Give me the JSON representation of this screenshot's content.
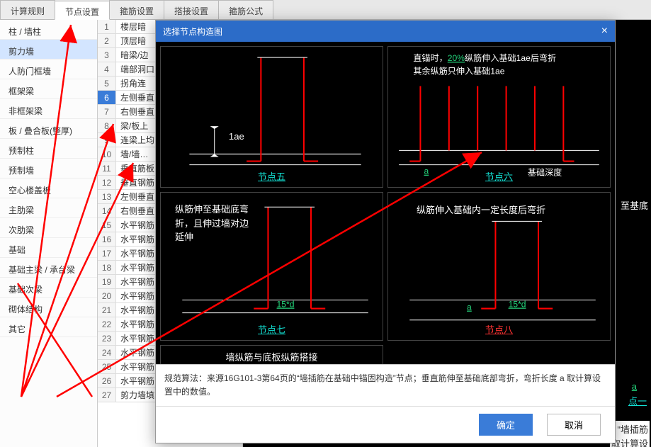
{
  "tabs": [
    "计算规则",
    "节点设置",
    "箍筋设置",
    "搭接设置",
    "箍筋公式"
  ],
  "active_tab_index": 1,
  "sidebar": {
    "items": [
      "柱 / 墙柱",
      "剪力墙",
      "人防门框墙",
      "框架梁",
      "非框架梁",
      "板 / 叠合板(整厚)",
      "预制柱",
      "预制墙",
      "空心楼盖板",
      "主肋梁",
      "次肋梁",
      "基础",
      "基础主梁 / 承台梁",
      "基础次梁",
      "砌体结构",
      "其它"
    ],
    "selected_index": 1
  },
  "grid": {
    "selected_row": 6,
    "rows": [
      "楼层暗",
      "顶层暗",
      "暗梁/边",
      "端部洞口",
      "拐角连",
      "左侧垂直",
      "右侧垂直",
      "梁/板上",
      "连梁上均",
      "墙/墙…",
      "垂直筋板",
      "垂直钢筋",
      "左侧垂直",
      "右侧垂直",
      "水平钢筋",
      "水平钢筋",
      "水平钢筋",
      "水平钢筋",
      "水平钢筋",
      "水平钢筋",
      "水平钢筋",
      "水平钢筋",
      "水平钢筋",
      "水平钢筋",
      "水平钢筋",
      "水平钢筋",
      "剪力墙填充梁定位 / 调整十并…"
    ]
  },
  "modal": {
    "title": "选择节点构造图",
    "close": "×",
    "nodes": {
      "five": {
        "caption": "节点五",
        "dim": "1ae"
      },
      "six": {
        "caption": "节点六",
        "note1": "直锚时，",
        "pct": "20%",
        "note2": "纵筋伸入基础1ae后弯折",
        "note3": "其余纵筋只伸入基础1ae",
        "extra": "基础深度",
        "a": "a"
      },
      "seven": {
        "caption": "节点七",
        "desc": "纵筋伸至基础底弯折，且伸过墙对边延伸",
        "dim": "15*d"
      },
      "eight": {
        "caption": "节点八",
        "desc": "纵筋伸入基础内一定长度后弯折",
        "dim": "15*d",
        "a": "a"
      },
      "bottom": {
        "caption": "墙纵筋与底板纵筋搭接"
      }
    },
    "footer": "规范算法：来源16G101-3第64页的“墙插筋在基础中锚固构造”节点；垂直筋伸至基础底部弯折，弯折长度 a 取计算设置中的数值。",
    "ok": "确定",
    "cancel": "取消"
  },
  "peek": {
    "t1": "至基底",
    "t2": "a",
    "t3": "点一",
    "t4": "\"墙插筋",
    "t5": "取计算设"
  }
}
